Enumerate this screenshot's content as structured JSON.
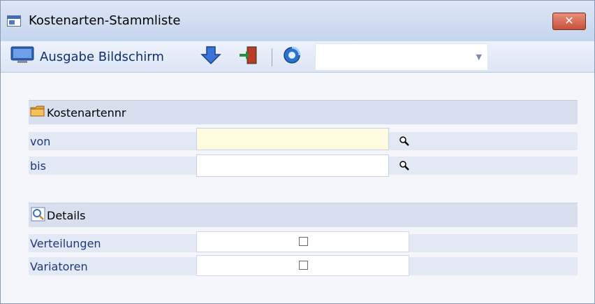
{
  "window": {
    "title": "Kostenarten-Stammliste",
    "close_glyph": "✕"
  },
  "toolbar": {
    "output_label": "Ausgabe Bildschirm",
    "icons": [
      "monitor-icon",
      "arrow-down-icon",
      "exit-door-icon",
      "refresh-icon"
    ],
    "combo_value": ""
  },
  "sections": {
    "kostenartennr": {
      "label": "Kostenartennr",
      "rows": {
        "von": {
          "label": "von",
          "value": ""
        },
        "bis": {
          "label": "bis",
          "value": ""
        }
      }
    },
    "details": {
      "label": "Details",
      "rows": {
        "verteilungen": {
          "label": "Verteilungen",
          "checked": false
        },
        "variatoren": {
          "label": "Variatoren",
          "checked": false
        }
      }
    }
  },
  "colors": {
    "title_bar": "#c5d5ed",
    "section_bg": "#d8e0ef",
    "row_bg": "#e3e9f4",
    "active_field": "#fffbe0",
    "label_text": "#1b3a7a"
  }
}
